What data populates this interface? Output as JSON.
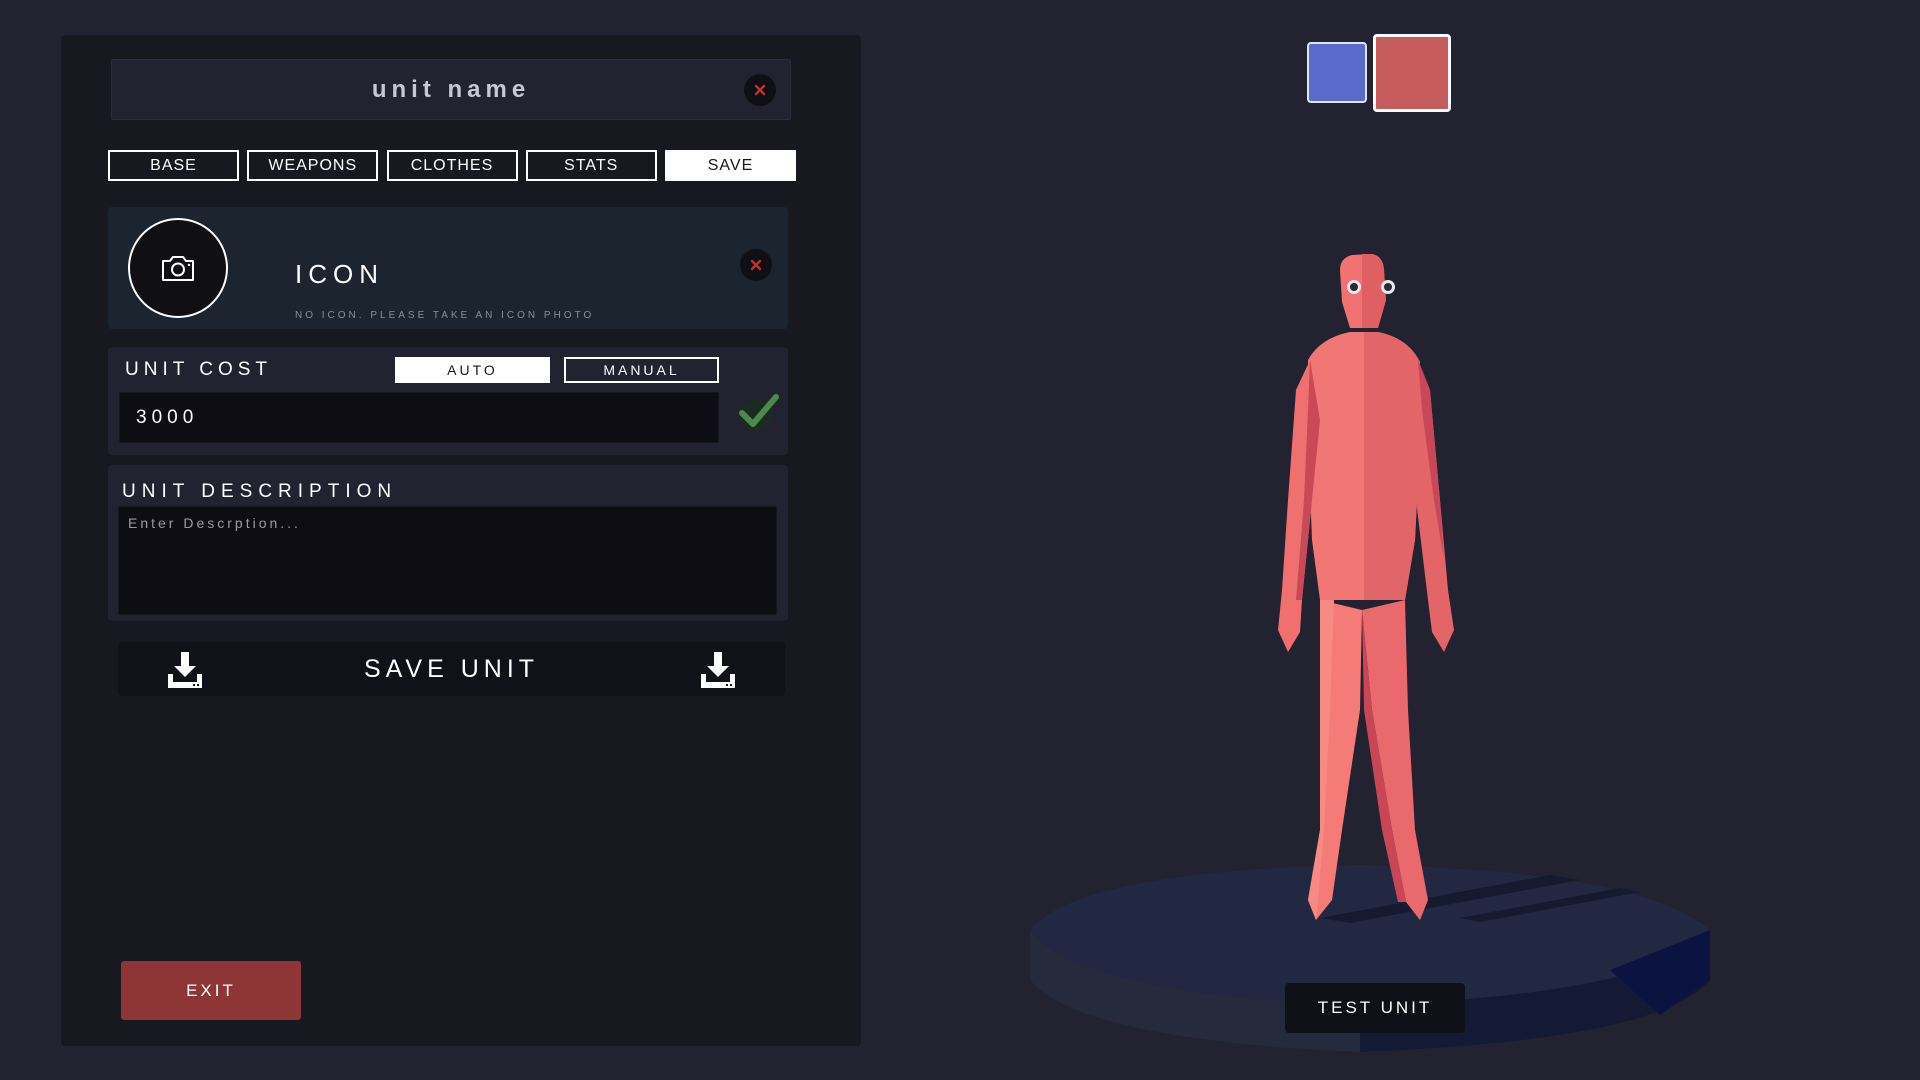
{
  "editor": {
    "unit_name": "unit name",
    "tabs": [
      {
        "label": "BASE",
        "active": false
      },
      {
        "label": "WEAPONS",
        "active": false
      },
      {
        "label": "CLOTHES",
        "active": false
      },
      {
        "label": "STATS",
        "active": false
      },
      {
        "label": "SAVE",
        "active": true
      }
    ],
    "icon_section": {
      "title": "ICON",
      "subtitle": "NO ICON. PLEASE TAKE AN ICON PHOTO"
    },
    "cost_section": {
      "label": "UNIT COST",
      "mode_auto": "AUTO",
      "mode_manual": "MANUAL",
      "selected_mode": "AUTO",
      "value": "3000"
    },
    "description_section": {
      "label": "UNIT DESCRIPTION",
      "placeholder": "Enter Descrption...",
      "value": ""
    },
    "save_button": "SAVE UNIT",
    "exit_button": "EXIT"
  },
  "preview": {
    "team_colors": [
      "#5a6bcd",
      "#c55b5b"
    ],
    "selected_team_color": "#c55b5b",
    "test_button": "TEST UNIT"
  },
  "icons": {
    "close": "close-icon",
    "camera": "camera-icon",
    "check": "check-icon",
    "download": "download-icon"
  },
  "colors": {
    "background": "#222231",
    "panel": "#181821",
    "exit": "#8e3535",
    "unit_body": "#f07070",
    "close_x": "#c03030",
    "check": "#4a8a4a"
  }
}
